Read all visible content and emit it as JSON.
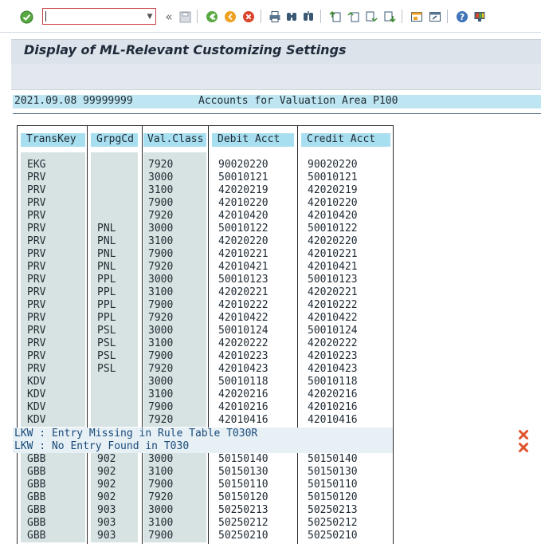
{
  "toolbar": {
    "command_value": "",
    "icons": [
      "enter-icon",
      "back-icon",
      "save-icon",
      "back-nav-icon",
      "exit-icon",
      "cancel-icon",
      "print-icon",
      "find-icon",
      "find-next-icon",
      "first-page-icon",
      "previous-page-icon",
      "next-page-icon",
      "last-page-icon",
      "create-session-icon",
      "shortcut-icon",
      "help-icon",
      "customize-layout-icon"
    ]
  },
  "title": "Display of ML-Relevant Customizing Settings",
  "list_header": {
    "left": "2021.09.08 99999999",
    "center": "Accounts for Valuation Area P100"
  },
  "table": {
    "columns": [
      "TransKey",
      "GrpgCd",
      "Val.Class",
      "Debit Acct",
      "Credit Acct"
    ],
    "rows_block1": [
      [
        "EKG",
        "",
        "7920",
        "90020220",
        "90020220"
      ],
      [
        "PRV",
        "",
        "3000",
        "50010121",
        "50010121"
      ],
      [
        "PRV",
        "",
        "3100",
        "42020219",
        "42020219"
      ],
      [
        "PRV",
        "",
        "7900",
        "42010220",
        "42010220"
      ],
      [
        "PRV",
        "",
        "7920",
        "42010420",
        "42010420"
      ],
      [
        "PRV",
        "PNL",
        "3000",
        "50010122",
        "50010122"
      ],
      [
        "PRV",
        "PNL",
        "3100",
        "42020220",
        "42020220"
      ],
      [
        "PRV",
        "PNL",
        "7900",
        "42010221",
        "42010221"
      ],
      [
        "PRV",
        "PNL",
        "7920",
        "42010421",
        "42010421"
      ],
      [
        "PRV",
        "PPL",
        "3000",
        "50010123",
        "50010123"
      ],
      [
        "PRV",
        "PPL",
        "3100",
        "42020221",
        "42020221"
      ],
      [
        "PRV",
        "PPL",
        "7900",
        "42010222",
        "42010222"
      ],
      [
        "PRV",
        "PPL",
        "7920",
        "42010422",
        "42010422"
      ],
      [
        "PRV",
        "PSL",
        "3000",
        "50010124",
        "50010124"
      ],
      [
        "PRV",
        "PSL",
        "3100",
        "42020222",
        "42020222"
      ],
      [
        "PRV",
        "PSL",
        "7900",
        "42010223",
        "42010223"
      ],
      [
        "PRV",
        "PSL",
        "7920",
        "42010423",
        "42010423"
      ],
      [
        "KDV",
        "",
        "3000",
        "50010118",
        "50010118"
      ],
      [
        "KDV",
        "",
        "3100",
        "42020216",
        "42020216"
      ],
      [
        "KDV",
        "",
        "7900",
        "42010216",
        "42010216"
      ],
      [
        "KDV",
        "",
        "7920",
        "42010416",
        "42010416"
      ]
    ],
    "messages": [
      "LKW : Entry Missing in Rule Table T030R",
      "LKW : No Entry Found in T030"
    ],
    "rows_block2": [
      [
        "GBB",
        "902",
        "3000",
        "50150140",
        "50150140"
      ],
      [
        "GBB",
        "902",
        "3100",
        "50150130",
        "50150130"
      ],
      [
        "GBB",
        "902",
        "7900",
        "50150110",
        "50150110"
      ],
      [
        "GBB",
        "902",
        "7920",
        "50150120",
        "50150120"
      ],
      [
        "GBB",
        "903",
        "3000",
        "50250213",
        "50250213"
      ],
      [
        "GBB",
        "903",
        "3100",
        "50250212",
        "50250212"
      ],
      [
        "GBB",
        "903",
        "7900",
        "50250210",
        "50250210"
      ]
    ]
  }
}
